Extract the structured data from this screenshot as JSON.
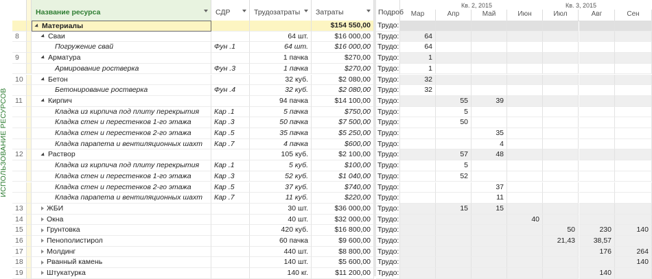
{
  "view_label": "ИСПОЛЬЗОВАНИЕ РЕСУРСОВ",
  "columns": {
    "name": "Название ресурса",
    "wbs": "СДР",
    "work": "Трудозатраты",
    "cost": "Затраты",
    "details": "Подроб"
  },
  "timeline": {
    "quarters": [
      "Кв. 2, 2015",
      "Кв. 3, 2015"
    ],
    "months": [
      "Мар",
      "Апр",
      "Май",
      "Июн",
      "Июл",
      "Авг",
      "Сен"
    ]
  },
  "detail_label": "Трудо:",
  "rows": [
    {
      "num": "",
      "name": "Материалы",
      "level": 0,
      "tri": "exp",
      "wbs": "",
      "work": "",
      "cost": "$154 550,00",
      "detail": "Трудо:",
      "tl": [
        "",
        "",
        "",
        "",
        "",
        "",
        ""
      ],
      "kind": "sum"
    },
    {
      "num": "8",
      "name": "Сваи",
      "level": 1,
      "tri": "exp",
      "wbs": "",
      "work": "64 шт.",
      "cost": "$16 000,00",
      "detail": "Трудо:",
      "tl": [
        "64",
        "",
        "",
        "",
        "",
        "",
        ""
      ],
      "kind": "grp"
    },
    {
      "num": "",
      "name": "Погружение свай",
      "level": 2,
      "tri": "",
      "wbs": "Фун .1",
      "work": "64 шт.",
      "cost": "$16 000,00",
      "detail": "Трудо:",
      "tl": [
        "64",
        "",
        "",
        "",
        "",
        "",
        ""
      ],
      "kind": "task"
    },
    {
      "num": "9",
      "name": "Арматура",
      "level": 1,
      "tri": "exp",
      "wbs": "",
      "work": "1 пачка",
      "cost": "$270,00",
      "detail": "Трудо:",
      "tl": [
        "1",
        "",
        "",
        "",
        "",
        "",
        ""
      ],
      "kind": "grp"
    },
    {
      "num": "",
      "name": "Армирование ростверка",
      "level": 2,
      "tri": "",
      "wbs": "Фун .3",
      "work": "1 пачка",
      "cost": "$270,00",
      "detail": "Трудо:",
      "tl": [
        "1",
        "",
        "",
        "",
        "",
        "",
        ""
      ],
      "kind": "task"
    },
    {
      "num": "10",
      "name": "Бетон",
      "level": 1,
      "tri": "exp",
      "wbs": "",
      "work": "32 куб.",
      "cost": "$2 080,00",
      "detail": "Трудо:",
      "tl": [
        "32",
        "",
        "",
        "",
        "",
        "",
        ""
      ],
      "kind": "grp"
    },
    {
      "num": "",
      "name": "Бетонирование ростверка",
      "level": 2,
      "tri": "",
      "wbs": "Фун .4",
      "work": "32 куб.",
      "cost": "$2 080,00",
      "detail": "Трудо:",
      "tl": [
        "32",
        "",
        "",
        "",
        "",
        "",
        ""
      ],
      "kind": "task"
    },
    {
      "num": "11",
      "name": "Кирпич",
      "level": 1,
      "tri": "exp",
      "wbs": "",
      "work": "94 пачка",
      "cost": "$14 100,00",
      "detail": "Трудо:",
      "tl": [
        "",
        "55",
        "39",
        "",
        "",
        "",
        ""
      ],
      "kind": "grp"
    },
    {
      "num": "",
      "name": "Кладка из кирпича под плиту перекрытия",
      "level": 2,
      "tri": "",
      "wbs": "Кар .1",
      "work": "5 пачка",
      "cost": "$750,00",
      "detail": "Трудо:",
      "tl": [
        "",
        "5",
        "",
        "",
        "",
        "",
        ""
      ],
      "kind": "task"
    },
    {
      "num": "",
      "name": "Кладка стен и перестенков 1-го этажа",
      "level": 2,
      "tri": "",
      "wbs": "Кар .3",
      "work": "50 пачка",
      "cost": "$7 500,00",
      "detail": "Трудо:",
      "tl": [
        "",
        "50",
        "",
        "",
        "",
        "",
        ""
      ],
      "kind": "task"
    },
    {
      "num": "",
      "name": "Кладка стен и перестенков 2-го этажа",
      "level": 2,
      "tri": "",
      "wbs": "Кар .5",
      "work": "35 пачка",
      "cost": "$5 250,00",
      "detail": "Трудо:",
      "tl": [
        "",
        "",
        "35",
        "",
        "",
        "",
        ""
      ],
      "kind": "task"
    },
    {
      "num": "",
      "name": "Кладка парапета и вентиляционных шахт",
      "level": 2,
      "tri": "",
      "wbs": "Кар .7",
      "work": "4 пачка",
      "cost": "$600,00",
      "detail": "Трудо:",
      "tl": [
        "",
        "",
        "4",
        "",
        "",
        "",
        ""
      ],
      "kind": "task"
    },
    {
      "num": "12",
      "name": "Раствор",
      "level": 1,
      "tri": "exp",
      "wbs": "",
      "work": "105 куб.",
      "cost": "$2 100,00",
      "detail": "Трудо:",
      "tl": [
        "",
        "57",
        "48",
        "",
        "",
        "",
        ""
      ],
      "kind": "grp"
    },
    {
      "num": "",
      "name": "Кладка из кирпича под плиту перекрытия",
      "level": 2,
      "tri": "",
      "wbs": "Кар .1",
      "work": "5 куб.",
      "cost": "$100,00",
      "detail": "Трудо:",
      "tl": [
        "",
        "5",
        "",
        "",
        "",
        "",
        ""
      ],
      "kind": "task"
    },
    {
      "num": "",
      "name": "Кладка стен и перестенков 1-го этажа",
      "level": 2,
      "tri": "",
      "wbs": "Кар .3",
      "work": "52 куб.",
      "cost": "$1 040,00",
      "detail": "Трудо:",
      "tl": [
        "",
        "52",
        "",
        "",
        "",
        "",
        ""
      ],
      "kind": "task"
    },
    {
      "num": "",
      "name": "Кладка стен и перестенков 2-го этажа",
      "level": 2,
      "tri": "",
      "wbs": "Кар .5",
      "work": "37 куб.",
      "cost": "$740,00",
      "detail": "Трудо:",
      "tl": [
        "",
        "",
        "37",
        "",
        "",
        "",
        ""
      ],
      "kind": "task"
    },
    {
      "num": "",
      "name": "Кладка парапета и вентиляционных шахт",
      "level": 2,
      "tri": "",
      "wbs": "Кар .7",
      "work": "11 куб.",
      "cost": "$220,00",
      "detail": "Трудо:",
      "tl": [
        "",
        "",
        "11",
        "",
        "",
        "",
        ""
      ],
      "kind": "task"
    },
    {
      "num": "13",
      "name": "ЖБИ",
      "level": 1,
      "tri": "col",
      "wbs": "",
      "work": "30 шт.",
      "cost": "$36 000,00",
      "detail": "Трудо:",
      "tl": [
        "",
        "15",
        "15",
        "",
        "",
        "",
        ""
      ],
      "kind": "grp"
    },
    {
      "num": "14",
      "name": "Окна",
      "level": 1,
      "tri": "col",
      "wbs": "",
      "work": "40 шт.",
      "cost": "$32 000,00",
      "detail": "Трудо:",
      "tl": [
        "",
        "",
        "",
        "40",
        "",
        "",
        ""
      ],
      "kind": "grp"
    },
    {
      "num": "15",
      "name": "Грунтовка",
      "level": 1,
      "tri": "col",
      "wbs": "",
      "work": "420 куб.",
      "cost": "$16 800,00",
      "detail": "Трудо:",
      "tl": [
        "",
        "",
        "",
        "",
        "50",
        "230",
        "140"
      ],
      "kind": "grp"
    },
    {
      "num": "16",
      "name": "Пенополистирол",
      "level": 1,
      "tri": "col",
      "wbs": "",
      "work": "60 пачка",
      "cost": "$9 600,00",
      "detail": "Трудо:",
      "tl": [
        "",
        "",
        "",
        "",
        "21,43",
        "38,57",
        ""
      ],
      "kind": "grp"
    },
    {
      "num": "17",
      "name": "Молдинг",
      "level": 1,
      "tri": "col",
      "wbs": "",
      "work": "440 шт.",
      "cost": "$8 800,00",
      "detail": "Трудо:",
      "tl": [
        "",
        "",
        "",
        "",
        "",
        "176",
        "264"
      ],
      "kind": "grp"
    },
    {
      "num": "18",
      "name": "Рванный камень",
      "level": 1,
      "tri": "col",
      "wbs": "",
      "work": "140 шт.",
      "cost": "$5 600,00",
      "detail": "Трудо:",
      "tl": [
        "",
        "",
        "",
        "",
        "",
        "",
        "140"
      ],
      "kind": "grp"
    },
    {
      "num": "19",
      "name": "Штукатурка",
      "level": 1,
      "tri": "col",
      "wbs": "",
      "work": "140 кг.",
      "cost": "$11 200,00",
      "detail": "Трудо:",
      "tl": [
        "",
        "",
        "",
        "",
        "",
        "140",
        ""
      ],
      "kind": "grp"
    }
  ]
}
